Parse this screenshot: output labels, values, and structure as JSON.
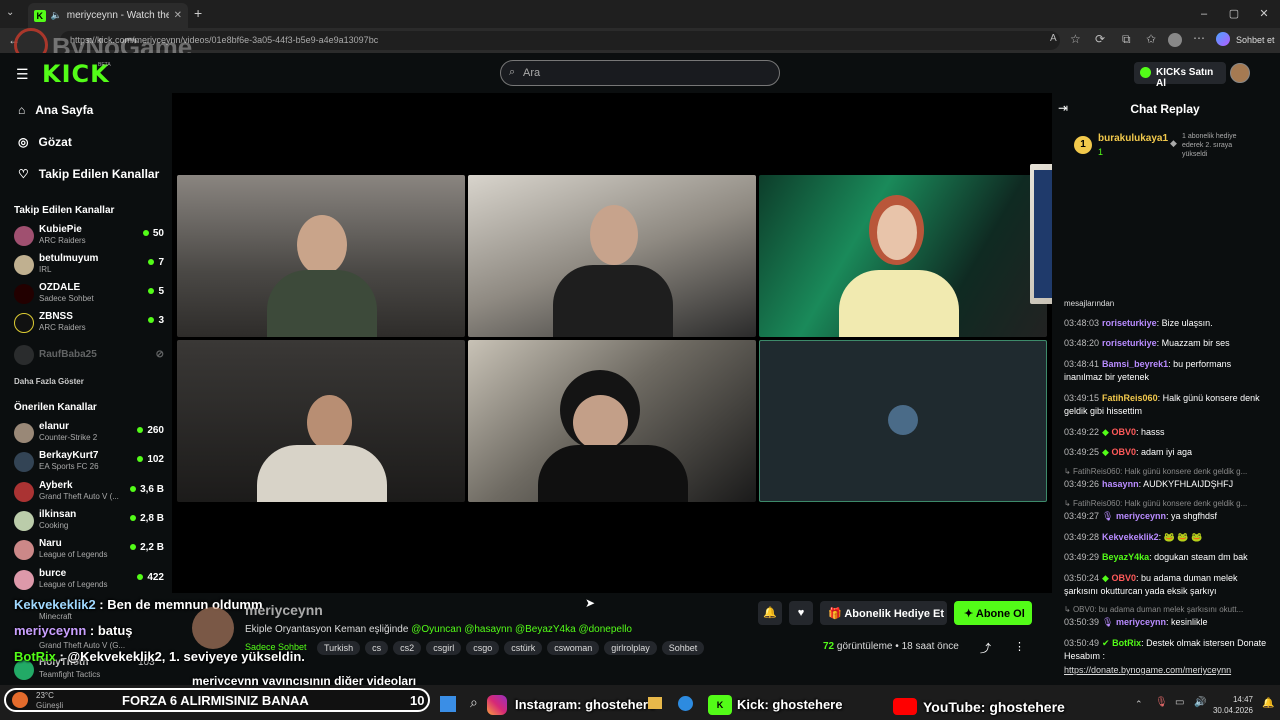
{
  "browser": {
    "tab_title": "meriyceynn - Watch the VOD",
    "url": "https://kick.com/meriyceynn/videos/01e8bf6e-3a05-44f3-b5e9-a4e9a13097bc",
    "url_visible": "https://kick.com/meriyceynn/videos/01e8bf6e-3a05-44f3-b5e9-a4e9a13097bc",
    "sohbet_btn": "Sohbet et",
    "watermark": "ByNoGame"
  },
  "header": {
    "logo": "KICK",
    "logo_beta": "BETA",
    "search_placeholder": "Ara",
    "buy_kicks": "KICKs Satın Al"
  },
  "sidebar": {
    "nav": [
      {
        "label": "Ana Sayfa",
        "icon": "home-icon"
      },
      {
        "label": "Gözat",
        "icon": "compass-icon"
      },
      {
        "label": "Takip Edilen Kanallar",
        "icon": "heart-icon"
      }
    ],
    "followed_title": "Takip Edilen Kanallar",
    "followed": [
      {
        "name": "KubiePie",
        "game": "ARC Raiders",
        "count": "50"
      },
      {
        "name": "betulmuyum",
        "game": "IRL",
        "count": "7"
      },
      {
        "name": "OZDALE",
        "game": "Sadece Sohbet",
        "count": "5"
      },
      {
        "name": "ZBNSS",
        "game": "ARC Raiders",
        "count": "3"
      },
      {
        "name": "RaufBaba25",
        "game": "",
        "count": ""
      }
    ],
    "show_more": "Daha Fazla Göster",
    "recommended_title": "Önerilen Kanallar",
    "recommended": [
      {
        "name": "elanur",
        "game": "Counter-Strike 2",
        "count": "260"
      },
      {
        "name": "BerkayKurt7",
        "game": "EA Sports FC 26",
        "count": "102"
      },
      {
        "name": "Ayberk",
        "game": "Grand Theft Auto V (...",
        "count": "3,6 B"
      },
      {
        "name": "ilkinsan",
        "game": "Cooking",
        "count": "2,8 B"
      },
      {
        "name": "Naru",
        "game": "League of Legends",
        "count": "2,2 B"
      },
      {
        "name": "burce",
        "game": "League of Legends",
        "count": "422"
      },
      {
        "name": "",
        "game": "Minecraft",
        "count": ""
      },
      {
        "name": "",
        "game": "Grand Theft Auto V (G...",
        "count": ""
      },
      {
        "name": "HolyTnoth",
        "game": "Teamfight Tactics",
        "count": "103"
      }
    ]
  },
  "video_info": {
    "channel": "meriyceynn",
    "category": "Sadece Sohbet",
    "title": "Ekiple Oryantasyon Keman eşliğinde",
    "mentions": [
      "@Oyuncan",
      "@hasaynn",
      "@BeyazY4ka",
      "@donepello"
    ],
    "tags": [
      "Turkish",
      "cs",
      "cs2",
      "csgirl",
      "csgo",
      "cstürk",
      "cswoman",
      "girlrolplay",
      "Sohbet"
    ],
    "views_count": "72",
    "views_label": "görüntüleme",
    "time_ago": "18 saat önce",
    "gift_btn": "Abonelik Hediye Et",
    "sub_btn": "Abone Ol",
    "more_videos": "meriyceynn yayıncısının diğer videoları"
  },
  "overlay_chat": [
    {
      "user": "Kekvekeklik2",
      "text": " : Ben de memnun oldumm"
    },
    {
      "user": "meriyceynn",
      "text": " : batuş"
    },
    {
      "user": "BotRix",
      "text": " : @Kekvekeklik2, 1. seviyeye yükseldin."
    }
  ],
  "chat": {
    "title": "Chat Replay",
    "pinned_user": "burakulukaya1",
    "pinned_rank": "1",
    "pinned_count": "1",
    "pinned_text": "1 abonelik hediye ederek 2. sıraya yükseldi",
    "partial": "mesajlarından",
    "messages": [
      {
        "t": "03:48:03",
        "user": "roriseturkiye",
        "color": "#b98cff",
        "text": ": Bize ulaşsın."
      },
      {
        "t": "03:48:20",
        "user": "roriseturkiye",
        "color": "#b98cff",
        "text": ": Muazzam bir ses"
      },
      {
        "t": "03:48:41",
        "user": "Bamsi_beyrek1",
        "color": "#b98cff",
        "text": ": bu performans inanılmaz bir yetenek"
      },
      {
        "t": "03:49:15",
        "user": "FatihReis060",
        "color": "#f2c94c",
        "text": ": Halk günü konsere denk geldik gibi hissettim"
      },
      {
        "t": "03:49:22",
        "user": "OBV0",
        "color": "#ff5a5a",
        "text": ": hasss"
      },
      {
        "t": "03:49:25",
        "user": "OBV0",
        "color": "#ff5a5a",
        "text": ": adam iyi aga"
      },
      {
        "reply": "FatihReis060: Halk günü konsere denk geldik g..."
      },
      {
        "t": "03:49:26",
        "user": "hasaynn",
        "color": "#b98cff",
        "text": ": AUDKYFHLAIJDŞHFJ"
      },
      {
        "reply": "FatihReis060: Halk günü konsere denk geldik g..."
      },
      {
        "t": "03:49:27",
        "user": "meriyceynn",
        "color": "#b98cff",
        "text": ": ya shgfhdsf"
      },
      {
        "t": "03:49:28",
        "user": "Kekvekeklik2",
        "color": "#b98cff",
        "text": ": 🐸 🐸 🐸"
      },
      {
        "t": "03:49:29",
        "user": "BeyazY4ka",
        "color": "#53fc18",
        "text": ": dogukan steam dm bak"
      },
      {
        "t": "03:50:24",
        "user": "OBV0",
        "color": "#ff5a5a",
        "text": ": bu adama duman melek şarkısını okutturcan yada eksik şarkıyı"
      },
      {
        "reply": "OBV0: bu adama duman melek şarkısını okutt..."
      },
      {
        "t": "03:50:39",
        "user": "meriyceynn",
        "color": "#b98cff",
        "text": ": kesinlikle"
      },
      {
        "t": "03:50:49",
        "user": "BotRix",
        "color": "#53fc18",
        "text": ": Destek olmak istersen Donate Hesabım :"
      }
    ],
    "donate_link": "https://donate.bynogame.com/meriyceynn"
  },
  "taskbar": {
    "weather_temp": "23°C",
    "weather_label": "Güneşli",
    "forza_text": "FORZA 6 ALIRMISINIZ BANAA",
    "forza_count": "10",
    "instagram": "Instagram: ghostehere",
    "kick": "Kick: ghostehere",
    "youtube": "YouTube: ghostehere",
    "time": "14:47",
    "date": "30.04.2026"
  },
  "colors": {
    "accent": "#53fc18",
    "bg": "#0b0e0f",
    "panel": "#24272c"
  }
}
